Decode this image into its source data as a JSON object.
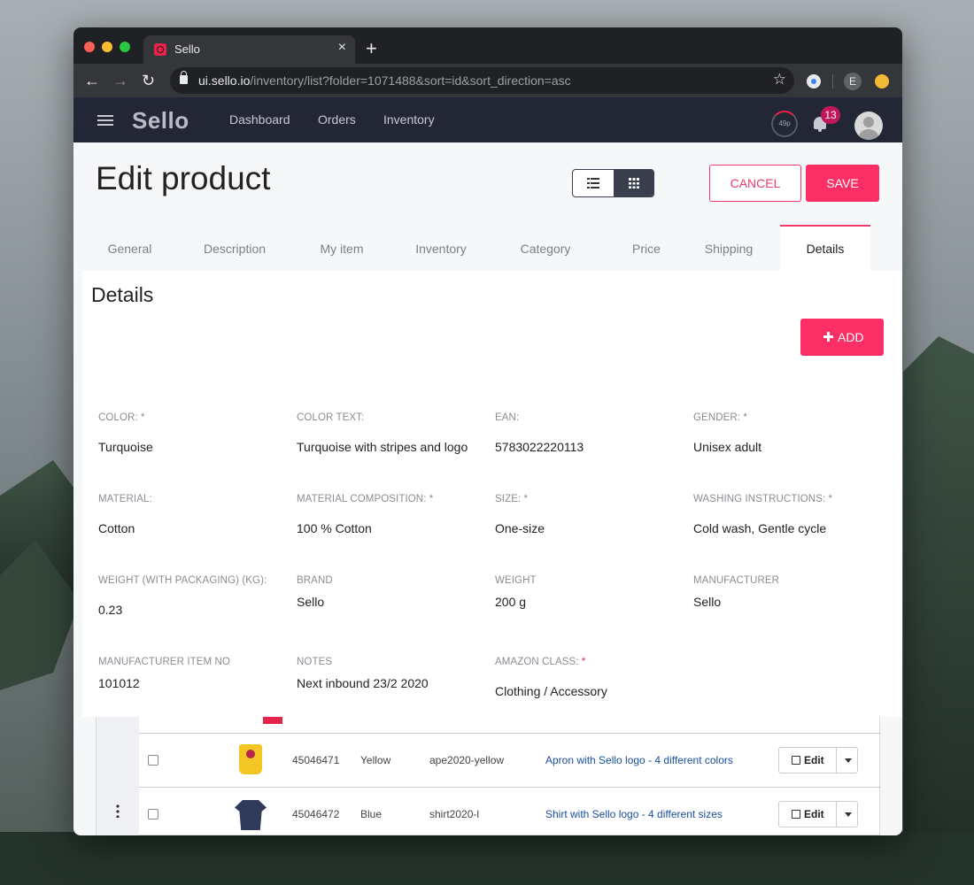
{
  "browser": {
    "tab_title": "Sello",
    "close_glyph": "×",
    "newtab_glyph": "+",
    "url_host": "ui.sello.io",
    "url_path": "/inventory/list?folder=1071488&sort=id&sort_direction=asc",
    "profile_initial": "E",
    "back_glyph": "←",
    "forward_glyph": "→",
    "reload_glyph": "↻",
    "star_glyph": "☆"
  },
  "appnav": {
    "brand": "Sello",
    "links": [
      "Dashboard",
      "Orders",
      "Inventory"
    ],
    "gauge_text": "49p",
    "notifications": "13"
  },
  "page": {
    "title": "Edit product",
    "cancel_label": "CANCEL",
    "save_label": "SAVE"
  },
  "tabs": [
    "General",
    "Description",
    "My item",
    "Inventory",
    "Category",
    "Price",
    "Shipping",
    "Details"
  ],
  "active_tab": "Details",
  "details": {
    "title": "Details",
    "add_label": "ADD",
    "fields": [
      {
        "label": "COLOR: *",
        "value": "Turquoise"
      },
      {
        "label": "COLOR TEXT:",
        "value": "Turquoise with stripes and logo"
      },
      {
        "label": "EAN:",
        "value": "5783022220113"
      },
      {
        "label": "GENDER: *",
        "value": "Unisex adult"
      },
      {
        "label": "MATERIAL:",
        "value": "Cotton"
      },
      {
        "label": "MATERIAL COMPOSITION: *",
        "value": "100 % Cotton"
      },
      {
        "label": "SIZE: *",
        "value": "One-size"
      },
      {
        "label": "WASHING INSTRUCTIONS: *",
        "value": "Cold wash, Gentle cycle"
      },
      {
        "label": "WEIGHT (WITH PACKAGING) (KG):",
        "value": "0.23"
      },
      {
        "label": "BRAND",
        "value": "Sello"
      },
      {
        "label": "WEIGHT",
        "value": "200 g"
      },
      {
        "label": "MANUFACTURER",
        "value": "Sello"
      },
      {
        "label": "MANUFACTURER ITEM NO",
        "value": "101012"
      },
      {
        "label": "NOTES",
        "value": "Next inbound 23/2 2020"
      },
      {
        "label": "AMAZON CLASS:",
        "required_mark": "*",
        "value": "Clothing / Accessory"
      }
    ]
  },
  "background_table": {
    "rows": [
      {
        "id": "45046471",
        "color": "Yellow",
        "sku": "ape2020-yellow",
        "title": "Apron with Sello logo - 4 different colors",
        "edit_label": "Edit"
      },
      {
        "id": "45046472",
        "color": "Blue",
        "sku": "shirt2020-l",
        "title": "Shirt with Sello logo - 4 different sizes",
        "edit_label": "Edit"
      }
    ]
  },
  "colors": {
    "accent": "#fb2e66",
    "navbar": "#232634",
    "link": "#1a4fa0"
  }
}
